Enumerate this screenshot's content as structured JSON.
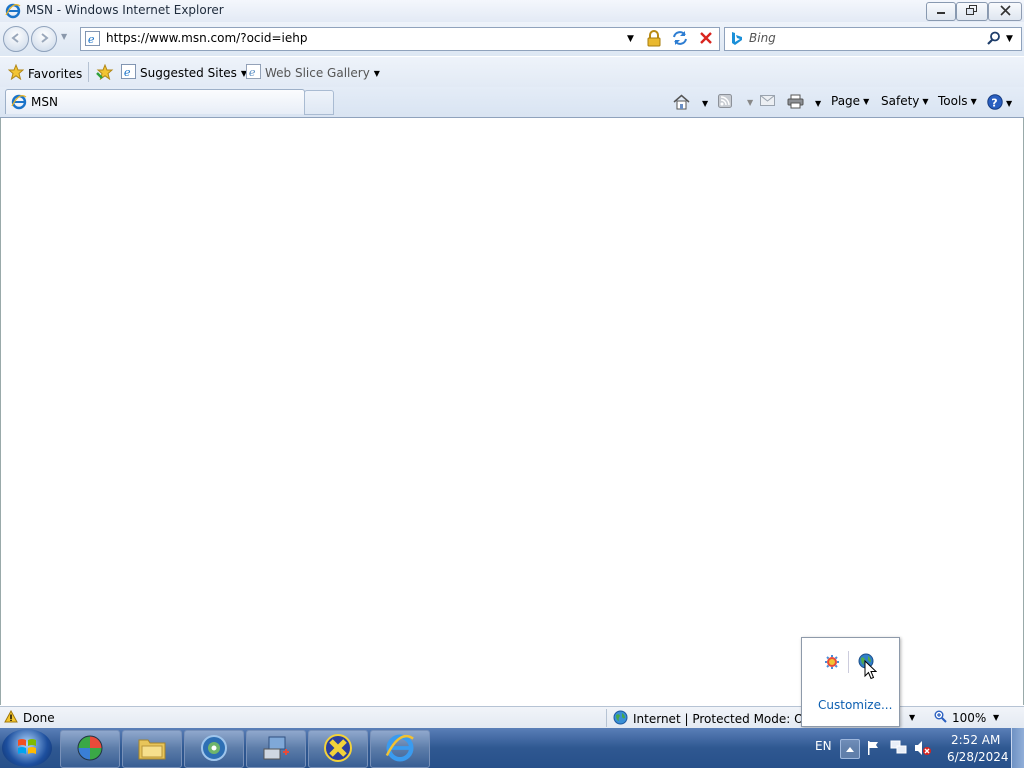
{
  "window": {
    "title": "MSN - Windows Internet Explorer"
  },
  "navbar": {
    "url": "https://www.msn.com/?ocid=iehp",
    "search_placeholder": "Bing"
  },
  "favorites_bar": {
    "favorites_label": "Favorites",
    "items": [
      {
        "label": "Suggested Sites"
      },
      {
        "label": "Web Slice Gallery"
      }
    ]
  },
  "tabs": [
    {
      "label": "MSN"
    }
  ],
  "command_bar": {
    "page_label": "Page",
    "safety_label": "Safety",
    "tools_label": "Tools"
  },
  "status_bar": {
    "status_text": "Done",
    "zone_text": "Internet | Protected Mode: On",
    "zoom": "100%"
  },
  "tray_popup": {
    "customize_label": "Customize..."
  },
  "taskbar": {
    "language": "EN",
    "time": "2:52 AM",
    "date": "6/28/2024"
  }
}
